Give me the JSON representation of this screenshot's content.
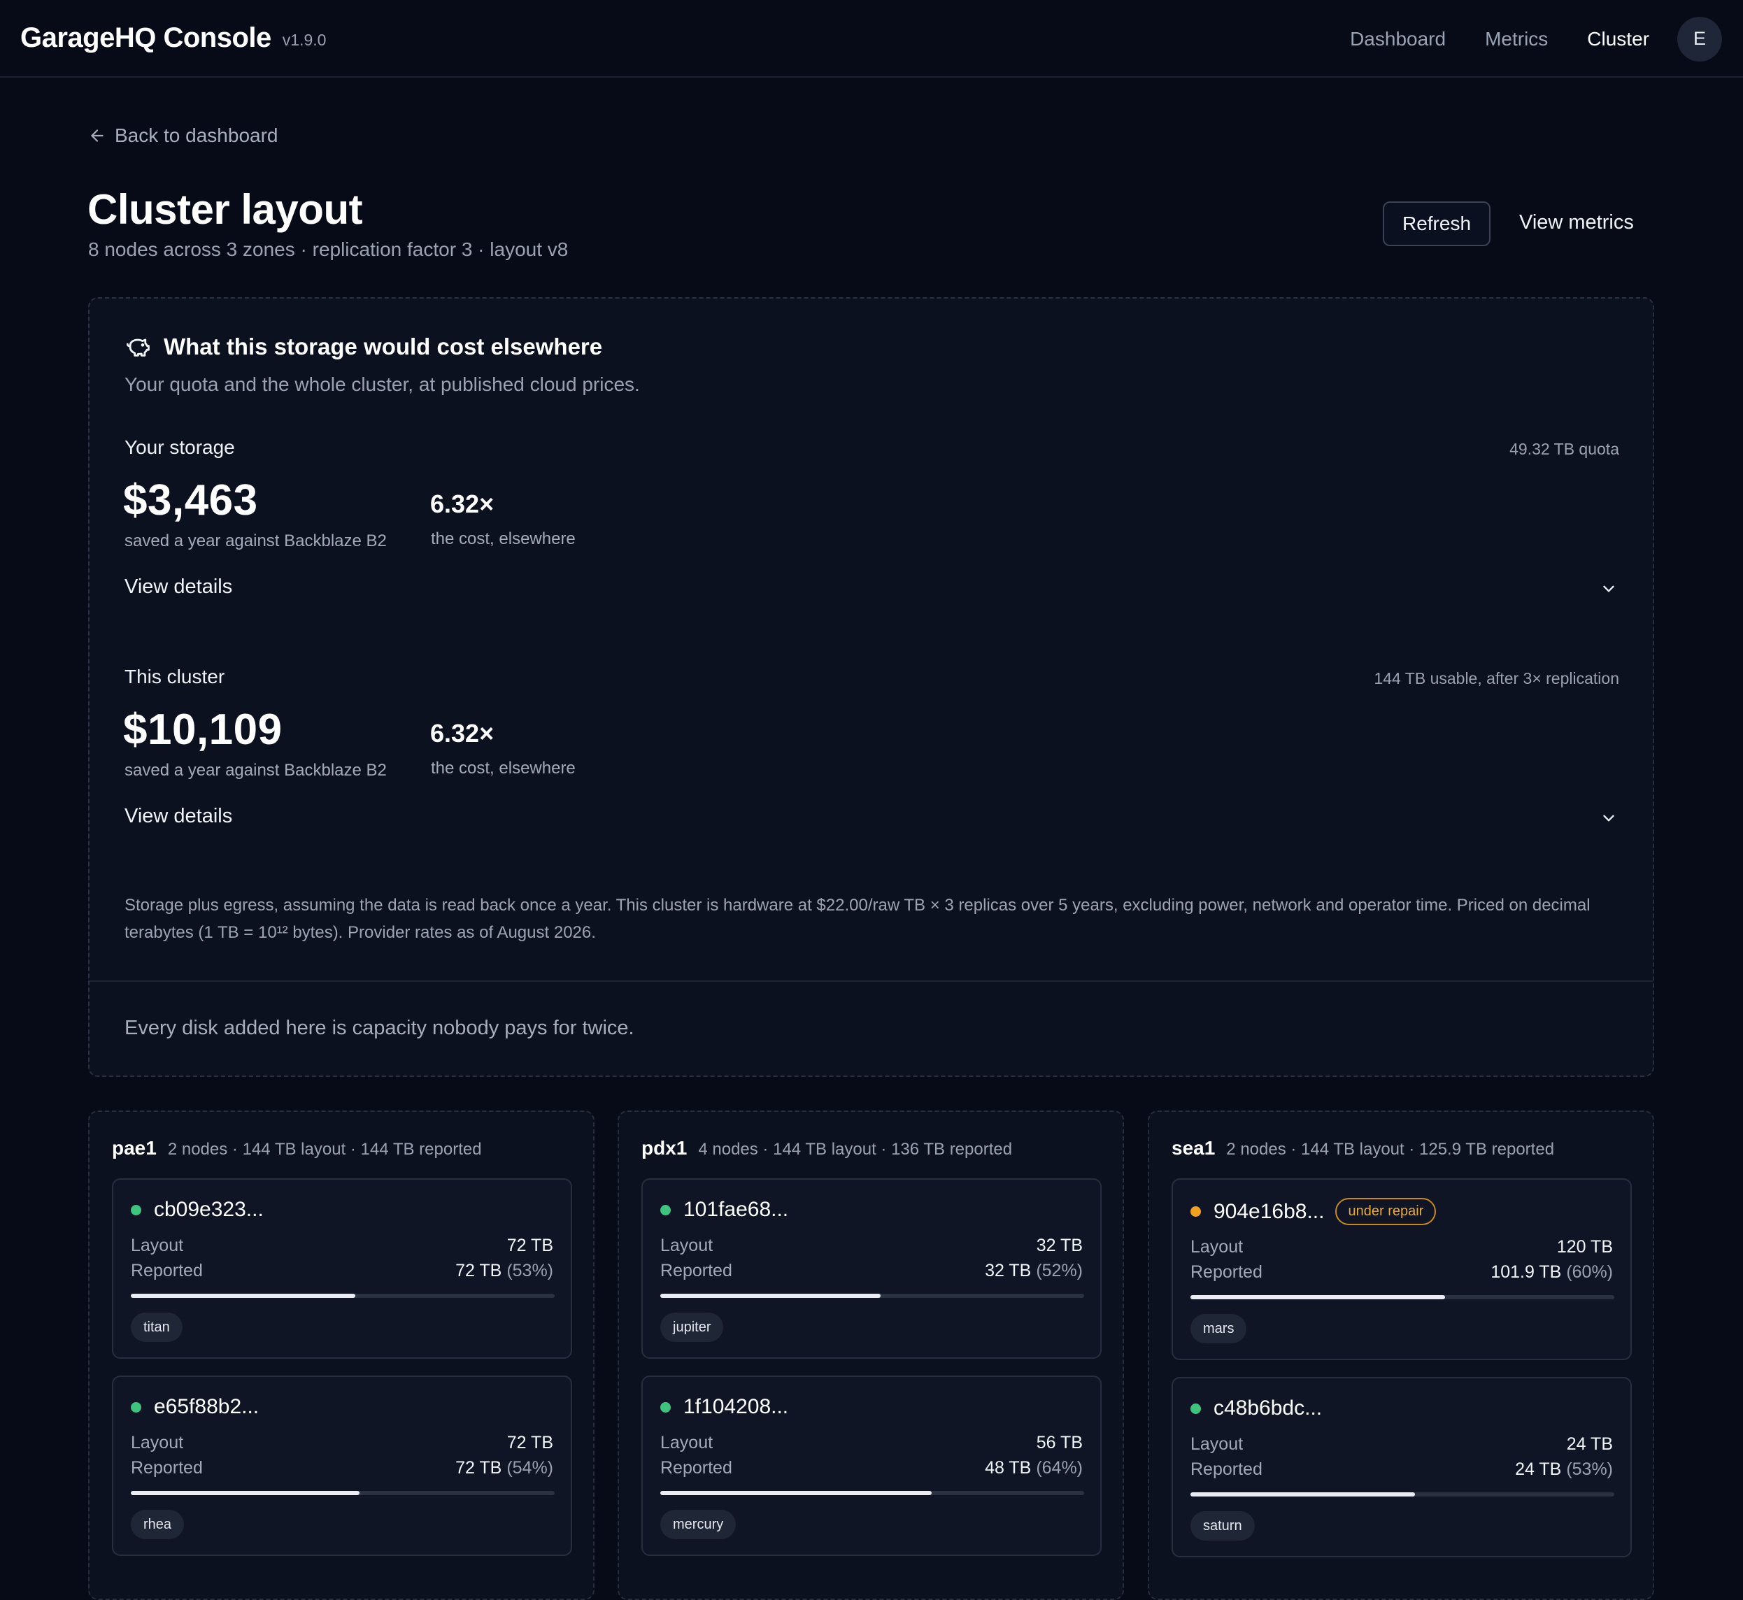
{
  "app": {
    "title": "GarageHQ Console",
    "version": "v1.9.0",
    "user_initial": "E"
  },
  "nav": {
    "items": [
      {
        "label": "Dashboard",
        "active": false
      },
      {
        "label": "Metrics",
        "active": false
      },
      {
        "label": "Cluster",
        "active": true
      }
    ]
  },
  "page": {
    "back_label": "Back to dashboard",
    "title": "Cluster layout",
    "subtitle": "8 nodes across 3 zones · replication factor 3 · layout v8",
    "refresh_label": "Refresh",
    "metrics_label": "View metrics"
  },
  "cost": {
    "icon": "piggy-bank-icon",
    "title": "What this storage would cost elsewhere",
    "description": "Your quota and the whole cluster, at published cloud prices.",
    "yours": {
      "label": "Your storage",
      "right": "49.32 TB quota",
      "amount": "$3,463",
      "amount_sub": "saved a year against Backblaze B2",
      "ratio": "6.32×",
      "ratio_sub": "the cost, elsewhere",
      "details": "View details"
    },
    "cluster": {
      "label": "This cluster",
      "right": "144 TB usable, after 3× replication",
      "amount": "$10,109",
      "amount_sub": "saved a year against Backblaze B2",
      "ratio": "6.32×",
      "ratio_sub": "the cost, elsewhere",
      "details": "View details"
    },
    "footnote": "Storage plus egress, assuming the data is read back once a year. This cluster is hardware at $22.00/raw TB × 3 replicas over 5 years, excluding power, network and operator time. Priced on decimal terabytes (1 TB = 10¹² bytes). Provider rates as of August 2026.",
    "tagline": "Every disk added here is capacity nobody pays for twice."
  },
  "labels": {
    "layout": "Layout",
    "reported": "Reported"
  },
  "colors": {
    "healthy": "#3ec47e",
    "repair": "#f0a21f"
  },
  "zones": [
    {
      "name": "pae1",
      "meta": "2 nodes · 144 TB layout · 144 TB reported",
      "nodes": [
        {
          "id": "cb09e323...",
          "status": "healthy",
          "layout": "72 TB",
          "reported": "72 TB",
          "pct": "(53%)",
          "usage": 0.53,
          "tag": "titan"
        },
        {
          "id": "e65f88b2...",
          "status": "healthy",
          "layout": "72 TB",
          "reported": "72 TB",
          "pct": "(54%)",
          "usage": 0.54,
          "tag": "rhea"
        }
      ]
    },
    {
      "name": "pdx1",
      "meta": "4 nodes · 144 TB layout · 136 TB reported",
      "nodes": [
        {
          "id": "101fae68...",
          "status": "healthy",
          "layout": "32 TB",
          "reported": "32 TB",
          "pct": "(52%)",
          "usage": 0.52,
          "tag": "jupiter"
        },
        {
          "id": "1f104208...",
          "status": "healthy",
          "layout": "56 TB",
          "reported": "48 TB",
          "pct": "(64%)",
          "usage": 0.64,
          "tag": "mercury"
        }
      ]
    },
    {
      "name": "sea1",
      "meta": "2 nodes · 144 TB layout · 125.9 TB reported",
      "nodes": [
        {
          "id": "904e16b8...",
          "status": "repair",
          "badge": "under repair",
          "layout": "120 TB",
          "reported": "101.9 TB",
          "pct": "(60%)",
          "usage": 0.6,
          "tag": "mars"
        },
        {
          "id": "c48b6bdc...",
          "status": "healthy",
          "layout": "24 TB",
          "reported": "24 TB",
          "pct": "(53%)",
          "usage": 0.53,
          "tag": "saturn"
        }
      ]
    }
  ]
}
